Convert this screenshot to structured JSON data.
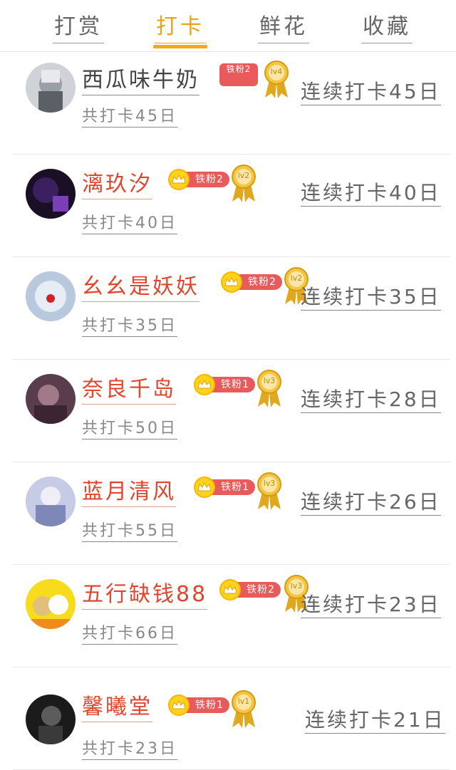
{
  "tabs": [
    {
      "label": "打赏"
    },
    {
      "label": "打卡",
      "active": true
    },
    {
      "label": "鲜花"
    },
    {
      "label": "收藏"
    }
  ],
  "colors": {
    "accent": "#f2a817",
    "name_red": "#e0452d",
    "badge_red": "#e95a5a",
    "crown_yellow": "#ffd21e",
    "divider": "#e8e8e8"
  },
  "rows": [
    {
      "name": "西瓜味牛奶",
      "badge_text": "铁粉2",
      "badge_crown": false,
      "medal_label": "lv4",
      "streak_prefix": "连续打卡",
      "streak_days": "45",
      "streak_unit": "日",
      "total_prefix": "共打卡",
      "total_days": "45",
      "total_unit": "日"
    },
    {
      "name": "漓玖汐",
      "badge_text": "铁粉2",
      "badge_crown": true,
      "medal_label": "lv2",
      "streak_prefix": "连续打卡",
      "streak_days": "40",
      "streak_unit": "日",
      "total_prefix": "共打卡",
      "total_days": "40",
      "total_unit": "日"
    },
    {
      "name": "幺幺是妖妖",
      "badge_text": "铁粉2",
      "badge_crown": true,
      "medal_label": "lv2",
      "streak_prefix": "连续打卡",
      "streak_days": "35",
      "streak_unit": "日",
      "total_prefix": "共打卡",
      "total_days": "35",
      "total_unit": "日"
    },
    {
      "name": "奈良千岛",
      "badge_text": "铁粉1",
      "badge_crown": true,
      "medal_label": "lv3",
      "streak_prefix": "连续打卡",
      "streak_days": "28",
      "streak_unit": "日",
      "total_prefix": "共打卡",
      "total_days": "50",
      "total_unit": "日"
    },
    {
      "name": "蓝月清风",
      "badge_text": "铁粉1",
      "badge_crown": true,
      "medal_label": "lv3",
      "streak_prefix": "连续打卡",
      "streak_days": "26",
      "streak_unit": "日",
      "total_prefix": "共打卡",
      "total_days": "55",
      "total_unit": "日"
    },
    {
      "name": "五行缺钱88",
      "badge_text": "铁粉2",
      "badge_crown": true,
      "medal_label": "lv3",
      "streak_prefix": "连续打卡",
      "streak_days": "23",
      "streak_unit": "日",
      "total_prefix": "共打卡",
      "total_days": "66",
      "total_unit": "日"
    },
    {
      "name": "馨曦堂",
      "badge_text": "铁粉1",
      "badge_crown": true,
      "medal_label": "lv1",
      "streak_prefix": "连续打卡",
      "streak_days": "21",
      "streak_unit": "日",
      "total_prefix": "共打卡",
      "total_days": "23",
      "total_unit": "日"
    }
  ]
}
